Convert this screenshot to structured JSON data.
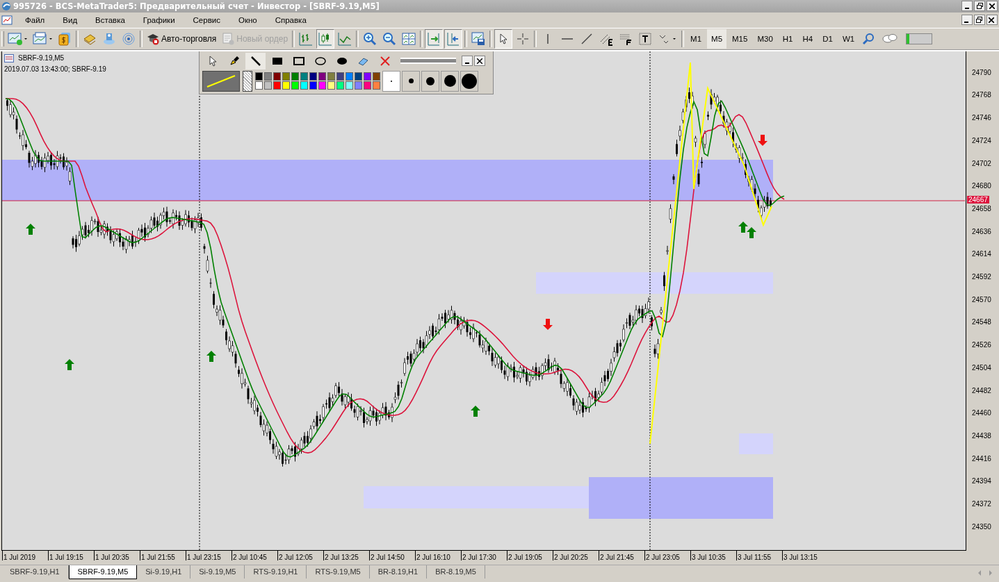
{
  "window": {
    "title": "995726 - BCS-MetaTrader5: Предварительный счет - Инвестор - [SBRF-9.19,M5]"
  },
  "menu": [
    "Файл",
    "Вид",
    "Вставка",
    "Графики",
    "Сервис",
    "Окно",
    "Справка"
  ],
  "toolbar": {
    "auto_trading": {
      "label": "Авто-торговля"
    },
    "new_order": {
      "label": "Новый ордер",
      "disabled": true
    },
    "chart_types": [
      {
        "kind": "bars",
        "selected": false
      },
      {
        "kind": "candles",
        "selected": true
      },
      {
        "kind": "line",
        "selected": false
      }
    ],
    "autoscroll": {
      "on": true
    },
    "chart_shift": {
      "on": true
    },
    "cursor_modes": [
      {
        "kind": "pointer",
        "selected": true
      },
      {
        "kind": "crosshair",
        "selected": false
      }
    ],
    "timeframes": [
      {
        "label": "M1",
        "selected": false
      },
      {
        "label": "M5",
        "selected": true
      },
      {
        "label": "M15",
        "selected": false
      },
      {
        "label": "M30",
        "selected": false
      },
      {
        "label": "H1",
        "selected": false
      },
      {
        "label": "H4",
        "selected": false
      },
      {
        "label": "D1",
        "selected": false
      },
      {
        "label": "W1",
        "selected": false
      }
    ],
    "meter": {
      "level": 0.12
    }
  },
  "chart": {
    "symbol": "SBRF-9.19,M5",
    "info": "2019.07.03 13:43:00; SBRF-9.19",
    "current_price": "24667",
    "price_axis": [
      "24790",
      "24768",
      "24746",
      "24724",
      "24702",
      "24680",
      "24658",
      "24636",
      "24614",
      "24592",
      "24570",
      "24548",
      "24526",
      "24504",
      "24482",
      "24460",
      "24438",
      "24416",
      "24394",
      "24372",
      "24350"
    ],
    "time_axis": [
      "1 Jul 2019",
      "1 Jul 19:15",
      "1 Jul 20:35",
      "1 Jul 21:55",
      "1 Jul 23:15",
      "2 Jul 10:45",
      "2 Jul 12:05",
      "2 Jul 13:25",
      "2 Jul 14:50",
      "2 Jul 16:10",
      "2 Jul 17:30",
      "2 Jul 19:05",
      "2 Jul 20:25",
      "2 Jul 21:45",
      "2 Jul 23:05",
      "3 Jul 10:35",
      "3 Jul 11:55",
      "3 Jul 13:15"
    ]
  },
  "drawing_palette": {
    "tools": [
      {
        "kind": "pointer",
        "selected": false
      },
      {
        "kind": "marker",
        "selected": false
      },
      {
        "kind": "line",
        "selected": true
      },
      {
        "kind": "filled-rect",
        "selected": false
      },
      {
        "kind": "rect",
        "selected": false
      },
      {
        "kind": "ellipse",
        "selected": false
      },
      {
        "kind": "filled-ellipse",
        "selected": false
      },
      {
        "kind": "eraser",
        "selected": false
      },
      {
        "kind": "delete",
        "selected": false
      }
    ],
    "colors": [
      {
        "color": "#000000"
      },
      {
        "color": "#808080"
      },
      {
        "color": "#800000"
      },
      {
        "color": "#808000"
      },
      {
        "color": "#008000"
      },
      {
        "color": "#008080"
      },
      {
        "color": "#000080"
      },
      {
        "color": "#800080"
      },
      {
        "color": "#808040"
      },
      {
        "color": "#404080"
      },
      {
        "color": "#0080ff"
      },
      {
        "color": "#004080"
      },
      {
        "color": "#8000ff"
      },
      {
        "color": "#804000"
      },
      {
        "color": "#ffffff"
      },
      {
        "color": "#c0c0c0"
      },
      {
        "color": "#ff0000"
      },
      {
        "color": "#ffff00"
      },
      {
        "color": "#00ff00"
      },
      {
        "color": "#00ffff"
      },
      {
        "color": "#0000ff"
      },
      {
        "color": "#ff00ff"
      },
      {
        "color": "#ffff80"
      },
      {
        "color": "#00ff80"
      },
      {
        "color": "#80ffff"
      },
      {
        "color": "#8080ff"
      },
      {
        "color": "#ff0080"
      },
      {
        "color": "#ff8040"
      }
    ],
    "sizes": [
      {
        "selected": true
      },
      {
        "selected": false
      },
      {
        "selected": false
      },
      {
        "selected": false
      },
      {
        "selected": false
      }
    ]
  },
  "tabs": [
    {
      "label": "SBRF-9.19,H1",
      "selected": false
    },
    {
      "label": "SBRF-9.19,M5",
      "selected": true
    },
    {
      "label": "Si-9.19,H1",
      "selected": false
    },
    {
      "label": "Si-9.19,M5",
      "selected": false
    },
    {
      "label": "RTS-9.19,H1",
      "selected": false
    },
    {
      "label": "RTS-9.19,M5",
      "selected": false
    },
    {
      "label": "BR-8.19,H1",
      "selected": false
    },
    {
      "label": "BR-8.19,M5",
      "selected": false
    }
  ]
}
